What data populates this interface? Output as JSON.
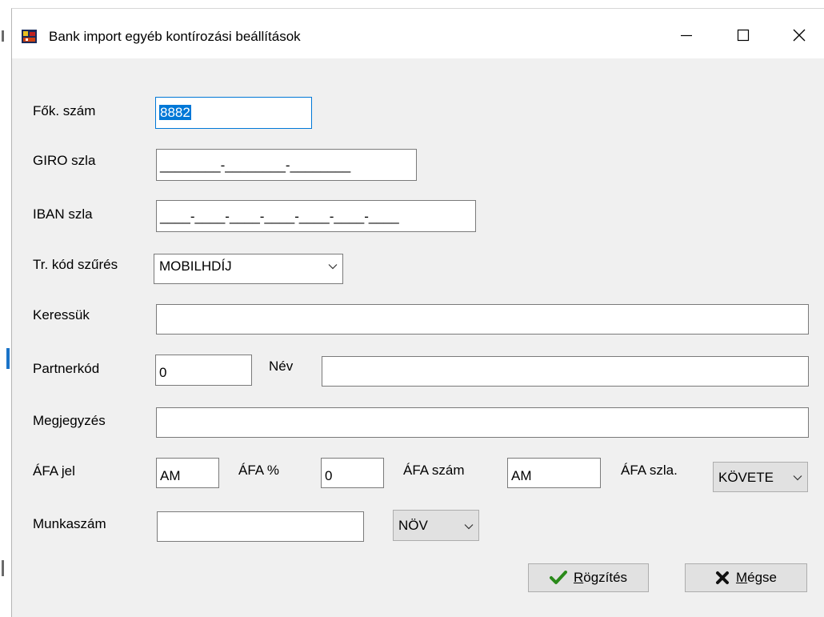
{
  "window": {
    "title": "Bank import egyéb kontírozási beállítások"
  },
  "form": {
    "fok_szam": {
      "label": "Fők. szám",
      "value": "8882"
    },
    "giro": {
      "label": "GIRO szla",
      "value": "________-________-________"
    },
    "iban": {
      "label": "IBAN szla",
      "value": "____-____-____-____-____-____-____"
    },
    "tr_kod": {
      "label": "Tr. kód szűrés",
      "value": "MOBILHDÍJ"
    },
    "keressuk": {
      "label": "Keressük",
      "value": ""
    },
    "partnerkod": {
      "label": "Partnerkód",
      "value": "0"
    },
    "nev": {
      "label": "Név",
      "value": ""
    },
    "megjegyzes": {
      "label": "Megjegyzés",
      "value": ""
    },
    "afa_jel": {
      "label": "ÁFA jel",
      "value": "AM"
    },
    "afa_pct": {
      "label": "ÁFA %",
      "value": "0"
    },
    "afa_szam": {
      "label": "ÁFA szám",
      "value": "AM"
    },
    "afa_szla": {
      "label": "ÁFA szla.",
      "value": "KÖVETE"
    },
    "munkaszam": {
      "label": "Munkaszám",
      "value": "",
      "combo_value": "NÖV"
    }
  },
  "buttons": {
    "save": {
      "mnemonic": "R",
      "rest": "ögzítés"
    },
    "cancel": {
      "mnemonic": "M",
      "rest": "égse"
    }
  },
  "colors": {
    "window_bg": "#f0f0f0",
    "selection": "#0078d7",
    "save_icon": "#2a8a1a",
    "cancel_icon": "#111111"
  }
}
